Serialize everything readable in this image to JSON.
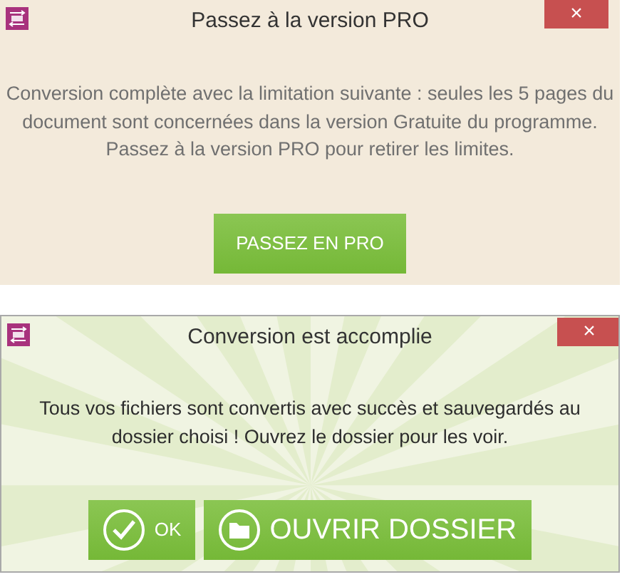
{
  "dialogs": [
    {
      "title": "Passez à la version PRO",
      "close": "×",
      "kind": "plain",
      "message": "Conversion complète avec la limitation suivante : seules les 5 pages du document sont concernées dans la version Gratuite du programme. Passez à la version PRO pour retirer les limites.",
      "buttons": [
        {
          "label": "PASSEZ EN PRO",
          "kind": "plain"
        }
      ]
    },
    {
      "title": "Conversion est accomplie",
      "close": "×",
      "kind": "sunburst",
      "message": "Tous vos fichiers sont convertis avec succès et sauvegardés au dossier choisi ! Ouvrez le dossier pour les voir.",
      "buttons": [
        {
          "label": "OK",
          "kind": "check"
        },
        {
          "label": "OUVRIR DOSSIER",
          "kind": "folder"
        }
      ]
    }
  ]
}
